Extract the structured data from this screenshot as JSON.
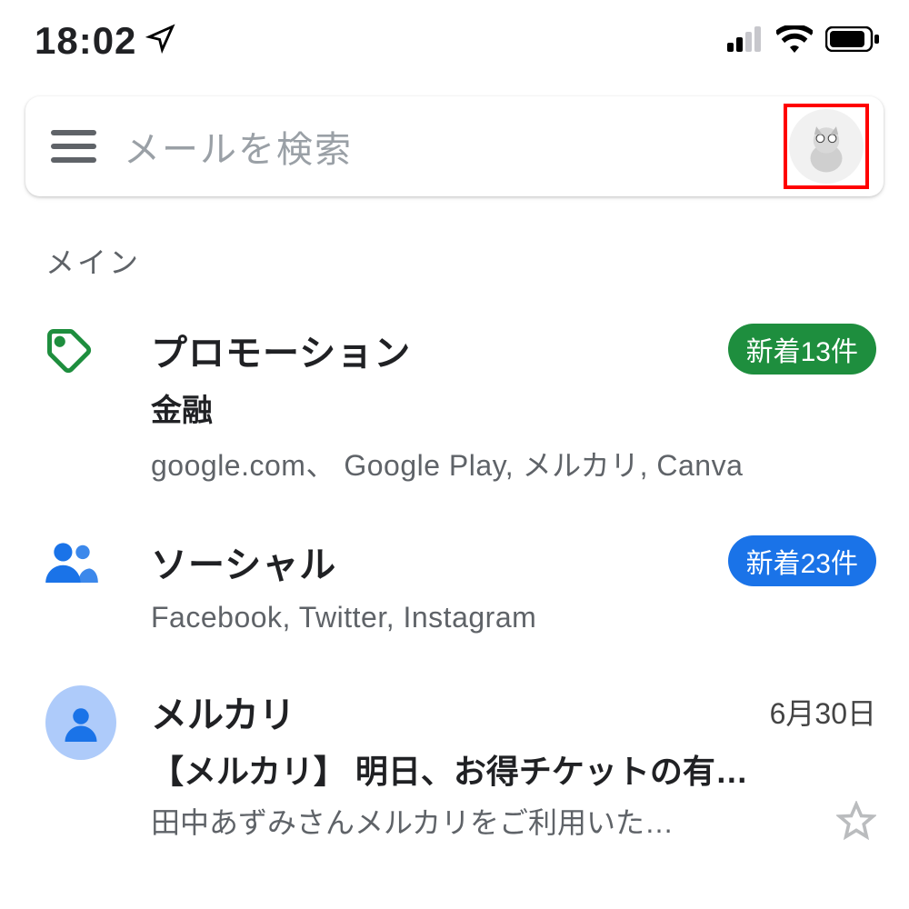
{
  "status": {
    "time": "18:02",
    "location_icon": "location-arrow"
  },
  "search": {
    "placeholder": "メールを検索"
  },
  "section_label": "メイン",
  "categories": [
    {
      "icon": "tag-icon",
      "title": "プロモーション",
      "badge": "新着13件",
      "badge_color": "green",
      "sub1": "金融",
      "sub2": "google.com、 Google Play, メルカリ, Canva"
    },
    {
      "icon": "people-icon",
      "title": "ソーシャル",
      "badge": "新着23件",
      "badge_color": "blue",
      "sub1": "",
      "sub2": "Facebook, Twitter, Instagram"
    }
  ],
  "email": {
    "sender": "メルカリ",
    "date": "6月30日",
    "subject": "【メルカリ】 明日、お得チケットの有…",
    "snippet": "田中あずみさんメルカリをご利用いた…"
  }
}
